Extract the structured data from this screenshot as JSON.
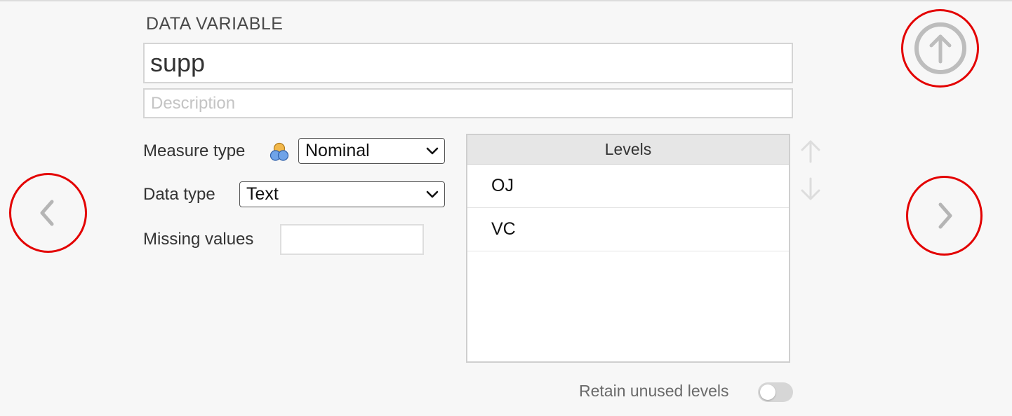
{
  "header": {
    "section_title": "DATA VARIABLE"
  },
  "variable": {
    "name": "supp",
    "description_value": "",
    "description_placeholder": "Description"
  },
  "settings": {
    "measure_type_label": "Measure type",
    "measure_type_value": "Nominal",
    "measure_type_icon": "nominal-icon",
    "data_type_label": "Data type",
    "data_type_value": "Text",
    "missing_values_label": "Missing values",
    "missing_values_value": ""
  },
  "levels": {
    "header": "Levels",
    "items": [
      {
        "label": "OJ"
      },
      {
        "label": "VC"
      }
    ],
    "move_up_icon": "arrow-up-icon",
    "move_down_icon": "arrow-down-icon"
  },
  "navigation": {
    "previous_icon": "chevron-left-icon",
    "next_icon": "chevron-right-icon",
    "collapse_icon": "arrow-up-circle-icon",
    "highlight_color": "#e30000"
  },
  "footer": {
    "retain_unused_label": "Retain unused levels",
    "retain_unused_enabled": false
  }
}
